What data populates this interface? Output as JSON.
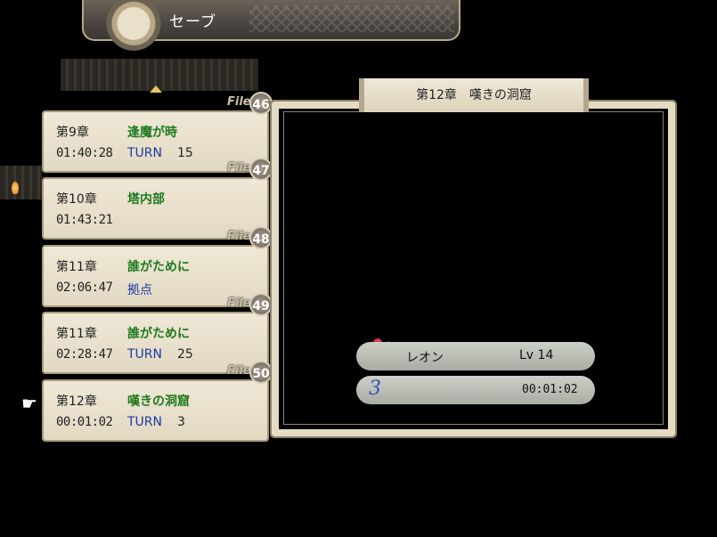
{
  "header": {
    "title": "セーブ"
  },
  "files": [
    {
      "no": "46",
      "file_label": "File",
      "chapter": "第9章",
      "title": "逢魔が時",
      "time": "01:40:28",
      "turn_label": "TURN",
      "turn": "15"
    },
    {
      "no": "47",
      "file_label": "File",
      "chapter": "第10章",
      "title": "塔内部",
      "time": "01:43:21",
      "turn_label": "",
      "turn": ""
    },
    {
      "no": "48",
      "file_label": "File",
      "chapter": "第11章",
      "title": "誰がために",
      "time": "02:06:47",
      "turn_label": "拠点",
      "turn": ""
    },
    {
      "no": "49",
      "file_label": "File",
      "chapter": "第11章",
      "title": "誰がために",
      "time": "02:28:47",
      "turn_label": "TURN",
      "turn": "25"
    },
    {
      "no": "50",
      "file_label": "File",
      "chapter": "第12章",
      "title": "嘆きの洞窟",
      "time": "00:01:02",
      "turn_label": "TURN",
      "turn": "3"
    }
  ],
  "detail": {
    "heading": "第12章　嘆きの洞窟",
    "unit_name": "レオン",
    "unit_level": "Lv 14",
    "turn_number": "3",
    "play_time": "00:01:02"
  },
  "colors": {
    "title_green": "#1f7a1f",
    "turn_blue": "#1e3aa8",
    "parchment": "#e8e0cc"
  },
  "icons": {
    "cursor": "pointing-hand-icon",
    "scroll_up": "up-arrow-icon"
  }
}
